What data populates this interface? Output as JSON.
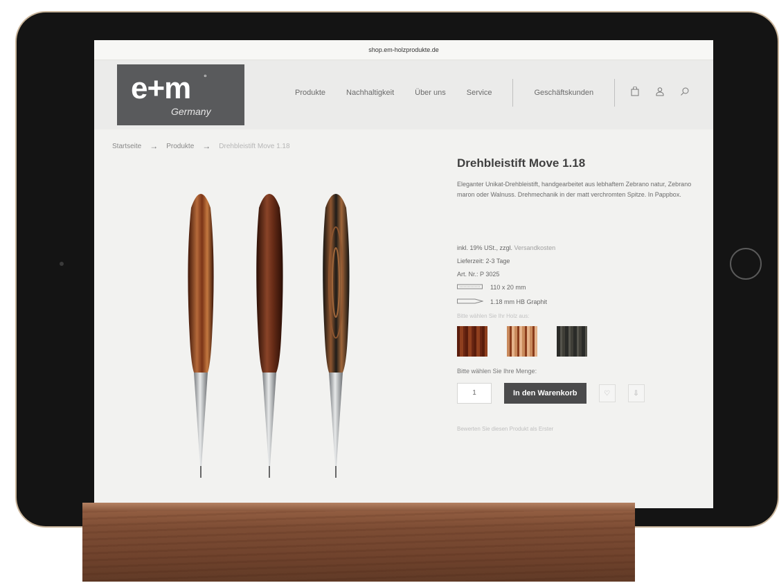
{
  "browser": {
    "url": "shop.em-holzprodukte.de"
  },
  "logo": {
    "main": "e+m",
    "mark": "°",
    "sub": "Germany"
  },
  "nav": {
    "items": [
      "Produkte",
      "Nachhaltigkeit",
      "Über uns",
      "Service",
      "Geschäftskunden"
    ]
  },
  "header_icons": [
    "bag-icon",
    "user-icon",
    "search-icon"
  ],
  "breadcrumb": {
    "items": [
      "Startseite",
      "Produkte",
      "Drehbleistift Move 1.18"
    ],
    "separator": "→"
  },
  "product": {
    "title": "Drehbleistift Move 1.18",
    "description": "Eleganter Unikat-Drehbleistift, handgearbeitet aus lebhaftem Zebrano natur, Zebrano maron oder Walnuss. Drehmechanik in der matt verchromten Spitze. In Pappbox.",
    "tax_prefix": "inkl. 19% USt., zzgl.",
    "tax_link": "Versandkosten",
    "delivery": "Lieferzeit: 2-3 Tage",
    "article": "Art. Nr.: P 3025",
    "size": "110 x 20 mm",
    "lead": "1.18 mm HB Graphit",
    "choose_wood": "Bitte wählen Sie Ihr Holz aus:",
    "swatch_colors": [
      "#7a2a16",
      "#b06a41",
      "#3b3b37"
    ],
    "qty_label": "Bitte wählen Sie Ihre Menge:",
    "qty_value": "1",
    "cart_button": "In den Warenkorb",
    "review_text": "Bewerten Sie diesen Produkt als Erster"
  },
  "pens": [
    {
      "color_dark": "#5a200f",
      "color_light": "#b56a3a"
    },
    {
      "color_dark": "#3e170b",
      "color_light": "#8a4428"
    },
    {
      "color_dark": "#1e1c18",
      "color_light": "#8e5630"
    }
  ]
}
